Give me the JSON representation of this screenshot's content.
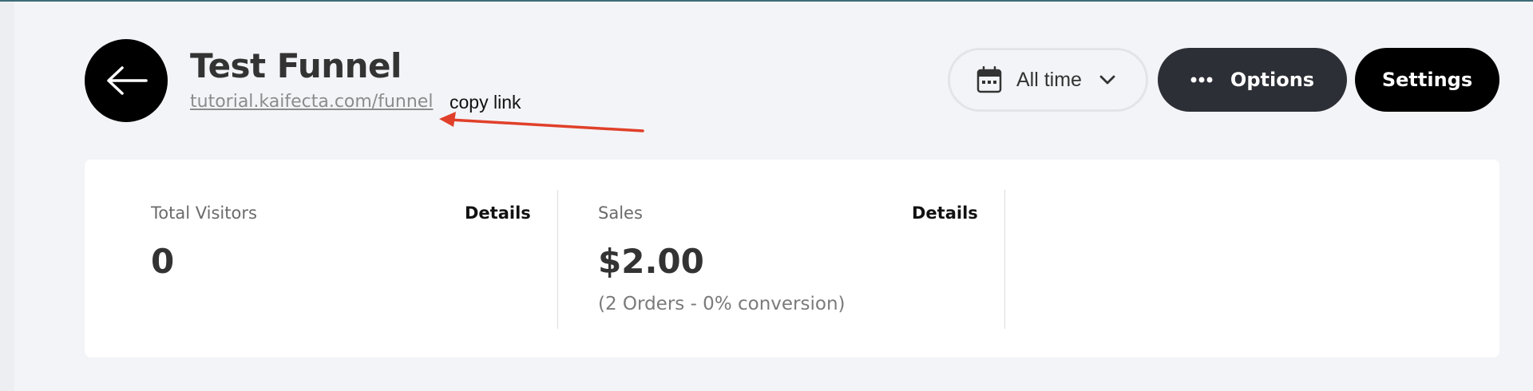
{
  "header": {
    "title": "Test Funnel",
    "url": "tutorial.kaifecta.com/funnel",
    "copy_link_label": "copy link"
  },
  "toolbar": {
    "date_range": "All time",
    "options_label": "Options",
    "settings_label": "Settings"
  },
  "stats": [
    {
      "label": "Total Visitors",
      "details_label": "Details",
      "value": "0",
      "sub": ""
    },
    {
      "label": "Sales",
      "details_label": "Details",
      "value": "$2.00",
      "sub": "(2 Orders - 0% conversion)"
    }
  ],
  "colors": {
    "background": "#f3f4f8",
    "annotation_arrow": "#e0402a",
    "options_button": "#2d2f36",
    "settings_button": "#000000"
  }
}
